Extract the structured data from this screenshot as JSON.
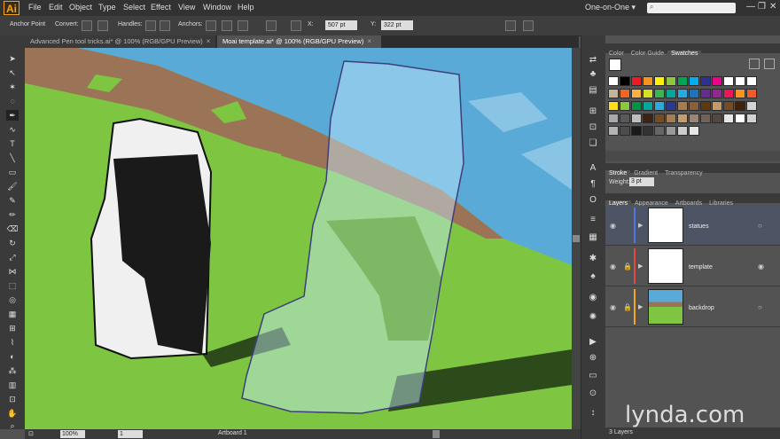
{
  "app": {
    "logo": "Ai"
  },
  "menu": [
    "File",
    "Edit",
    "Object",
    "Type",
    "Select",
    "Effect",
    "View",
    "Window",
    "Help"
  ],
  "workspace": "One-on-One ▾",
  "window_controls": [
    "—",
    "❐",
    "✕"
  ],
  "control_bar": {
    "anchor_point": "Anchor Point",
    "convert": "Convert:",
    "handles": "Handles:",
    "anchors": "Anchors:",
    "x_label": "X:",
    "x_value": "507 pt",
    "y_label": "Y:",
    "y_value": "322 pt"
  },
  "tabs": [
    {
      "label": "Advanced Pen tool tricks.ai* @ 100% (RGB/GPU Preview)",
      "close": "×"
    },
    {
      "label": "Moai template.ai* @ 100% (RGB/GPU Preview)",
      "close": "×"
    }
  ],
  "status": {
    "zoom": "100%",
    "artboard_num": "1",
    "artboard_label": "Artboard 1"
  },
  "color_panel": {
    "tabs": [
      "Color",
      "Color Guide",
      "Swatches"
    ],
    "swatches": [
      "#ffffff",
      "#000000",
      "#ed1c24",
      "#f7941d",
      "#fff200",
      "#8dc63f",
      "#00a651",
      "#00aeef",
      "#2e3192",
      "#ec008c",
      "#ffffff",
      "#ffffff",
      "#ffffff",
      "#c2b59b",
      "#f26522",
      "#fbb040",
      "#d7df23",
      "#39b54a",
      "#00a79d",
      "#27aae1",
      "#1c75bc",
      "#662d91",
      "#92278f",
      "#ed145b",
      "#f7941d",
      "#f15a29",
      "#ffde17",
      "#8dc63f",
      "#009444",
      "#00a99d",
      "#29abe2",
      "#2b3990",
      "#a97c50",
      "#8b5e3c",
      "#603913",
      "#c49a6c",
      "#754c24",
      "#42210b",
      "#d1d3d4",
      "#a7a9ac",
      "#58595b",
      "#bcbec0",
      "#3c2415",
      "#754c24",
      "#a67c52",
      "#c69c6d",
      "#998675",
      "#736357",
      "#534741",
      "#e6e7e8",
      "#ffffff",
      "#d0d2d3",
      "#b3b3b3",
      "#4d4d4d",
      "#1a1a1a",
      "#333333",
      "#666666",
      "#999999",
      "#cccccc",
      "#e6e6e6"
    ]
  },
  "stroke_panel": {
    "tabs": [
      "Stroke",
      "Gradient",
      "Transparency"
    ],
    "weight_label": "Weight:",
    "weight_value": "3 pt"
  },
  "layers_panel": {
    "tabs": [
      "Layers",
      "Appearance",
      "Artboards",
      "Libraries"
    ],
    "layers": [
      {
        "name": "statues",
        "color": "#4f78e0"
      },
      {
        "name": "template",
        "color": "#e34b4b"
      },
      {
        "name": "backdrop",
        "color": "#f3a524"
      }
    ],
    "footer": "3 Layers"
  },
  "watermark": "lynda.com"
}
